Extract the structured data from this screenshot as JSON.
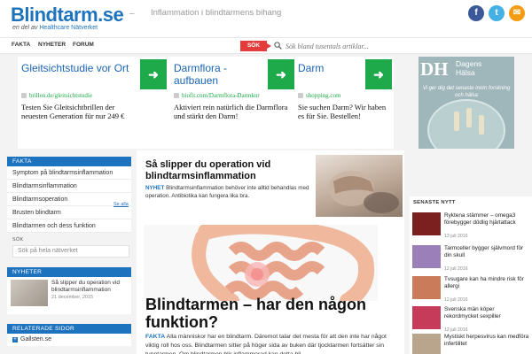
{
  "header": {
    "logo": "Blindtarm.se",
    "logo_sub_prefix": "en del av",
    "logo_sub_brand": "Healthcare Nätverket",
    "dash": "–",
    "tagline": "Inflammation i blindtarmens bihang",
    "social": [
      {
        "name": "facebook",
        "glyph": "f"
      },
      {
        "name": "twitter",
        "glyph": "t"
      },
      {
        "name": "mail",
        "glyph": "✉"
      }
    ]
  },
  "nav": {
    "items": [
      "FAKTA",
      "NYHETER",
      "FORUM"
    ],
    "search_tag": "SÖK",
    "search_placeholder": "Sök bland tusentals artiklar..."
  },
  "ads": [
    {
      "title": "Gleitsichtstudie vor Ort",
      "arrow": "➜",
      "url": "brillen.de/gleitsichtstudie",
      "desc": "Testen Sie Gleitsichtbrillen der neuesten Generation für nur 249 €"
    },
    {
      "title": "Darmflora - aufbauen",
      "arrow": "➜",
      "url": "biofit.com/Darmflora-Darmkur",
      "desc": "Aktiviert rein natürlich die Darmflora und stärkt den Darm!"
    },
    {
      "title": "Darm",
      "arrow": "➜",
      "url": "shopping.com",
      "desc": "Sie suchen Darm? Wir haben es für Sie. Bestellen!"
    }
  ],
  "dh_ad": {
    "logo": "DH",
    "name_line1": "Dagens",
    "name_line2": "Hälsa",
    "text": "Vi ger dig det senaste inom forskning och hälsa"
  },
  "sidebar": {
    "fakta_header": "FAKTA",
    "fakta_items": [
      "Symptom på blindtarmsinflammation",
      "Blindtarmsinflammation",
      "Blindtarmsoperation",
      "Brusten blindtarm",
      "Blindtarmen och dess funktion"
    ],
    "search_label": "SÖK",
    "search_placeholder": "Sök på hela nätverket",
    "news_header": "NYHETER",
    "news_title": "Så slipper du operation vid blindtarmsinflammation",
    "news_date": "21 december, 2015",
    "news_more": "Se alla",
    "related_header": "RELATERADE SIDOR",
    "related_items": [
      "Gallsten.se"
    ]
  },
  "main": {
    "feature_title": "Så slipper du operation vid blindtarmsinflammation",
    "feature_tag": "NYHET",
    "feature_body": "Blindtarmsinflammation behöver inte alltid behandlas med operation. Antibiotika kan fungera lika bra.",
    "article_title": "Blindtarmen – har den någon funktion?",
    "article_tag": "FAKTA",
    "article_body": "Alla människor har en blindtarm. Däremot talar det mesta för att den inte har något viktig roll hos oss. Blindtarmen sitter på höger sida av buken där tjocktarmen fortsätter sin tunntarmen. Om blindtarmen blir inflammerad kan detta bli"
  },
  "right": {
    "header": "SENASTE NYTT",
    "items": [
      {
        "title": "Ryktena stämmer – omega3 förebygger dödlig hjärtattack",
        "date": "13 juli 2016",
        "color": "#7b1f1f"
      },
      {
        "title": "Tarmceller bygger självmord för din skull",
        "date": "12 juli 2016",
        "color": "#9b7fb8"
      },
      {
        "title": "Tvsugare kan ha mindre risk för allergi",
        "date": "12 juli 2016",
        "color": "#c97b5a"
      },
      {
        "title": "Svenska män köper rekordmycket sexpiller",
        "date": "12 juli 2016",
        "color": "#c63a5a"
      },
      {
        "title": "Mystiskt herpesvirus kan medföra infertilitet",
        "date": "",
        "color": "#b9a58c"
      }
    ]
  }
}
